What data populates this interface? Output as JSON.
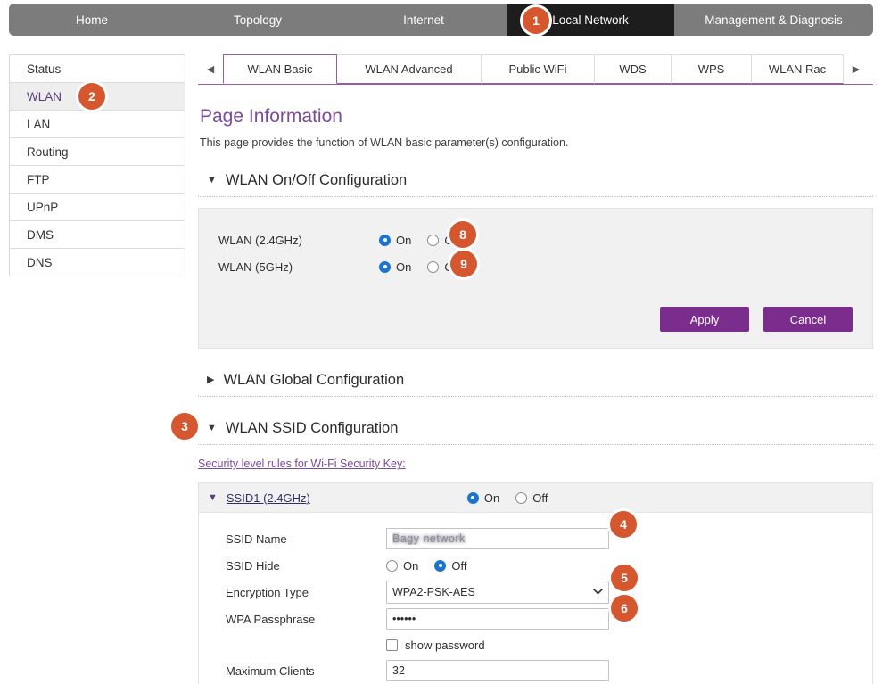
{
  "topnav": {
    "items": [
      {
        "label": "Home",
        "active": false
      },
      {
        "label": "Topology",
        "active": false
      },
      {
        "label": "Internet",
        "active": false
      },
      {
        "label": "Local Network",
        "active": true
      },
      {
        "label": "Management & Diagnosis",
        "active": false
      }
    ],
    "active_badge": "1"
  },
  "sidebar": {
    "items": [
      {
        "label": "Status"
      },
      {
        "label": "WLAN"
      },
      {
        "label": "LAN"
      },
      {
        "label": "Routing"
      },
      {
        "label": "FTP"
      },
      {
        "label": "UPnP"
      },
      {
        "label": "DMS"
      },
      {
        "label": "DNS"
      }
    ],
    "selected_badge": "2"
  },
  "tabs": {
    "left_arrow": "◀",
    "right_arrow": "▶",
    "items": [
      {
        "label": "WLAN Basic",
        "active": true
      },
      {
        "label": "WLAN Advanced",
        "active": false
      },
      {
        "label": "Public WiFi",
        "active": false
      },
      {
        "label": "WDS",
        "active": false
      },
      {
        "label": "WPS",
        "active": false
      },
      {
        "label": "WLAN Rac",
        "active": false
      }
    ]
  },
  "page": {
    "title": "Page Information",
    "description": "This page provides the function of WLAN basic parameter(s) configuration."
  },
  "onoff_section": {
    "caret": "▼",
    "title": "WLAN On/Off Configuration",
    "rows": [
      {
        "label": "WLAN (2.4GHz)",
        "on_label": "On",
        "off_label": "Off",
        "value": "On",
        "badge": "8"
      },
      {
        "label": "WLAN (5GHz)",
        "on_label": "On",
        "off_label": "Off",
        "value": "On",
        "badge": "9"
      }
    ],
    "apply_label": "Apply",
    "cancel_label": "Cancel"
  },
  "global_section": {
    "caret": "▶",
    "title": "WLAN Global Configuration"
  },
  "ssid_section": {
    "caret": "▼",
    "title": "WLAN SSID Configuration",
    "badge": "3",
    "security_link": "Security level rules for Wi-Fi Security Key:",
    "ssid1": {
      "caret": "▼",
      "name": "SSID1 (2.4GHz)",
      "on_label": "On",
      "off_label": "Off",
      "value": "On",
      "fields": {
        "ssid_name": {
          "label": "SSID Name",
          "value": "Bagy network",
          "badge": "4"
        },
        "ssid_hide": {
          "label": "SSID Hide",
          "on_label": "On",
          "off_label": "Off",
          "value": "Off"
        },
        "encryption_type": {
          "label": "Encryption Type",
          "value": "WPA2-PSK-AES",
          "chevron": "⌄",
          "badge": "5"
        },
        "wpa_passphrase": {
          "label": "WPA Passphrase",
          "value": "••••••",
          "badge": "6"
        },
        "show_password": {
          "label": "show password",
          "checked": false
        },
        "maximum_clients": {
          "label": "Maximum Clients",
          "value": "32"
        }
      }
    }
  },
  "colors": {
    "brand_purple": "#7b2d8e",
    "badge_orange": "#d6562e",
    "radio_blue": "#1975d1",
    "nav_gray": "#7c7c7c",
    "nav_active_black": "#1d1d1d"
  }
}
